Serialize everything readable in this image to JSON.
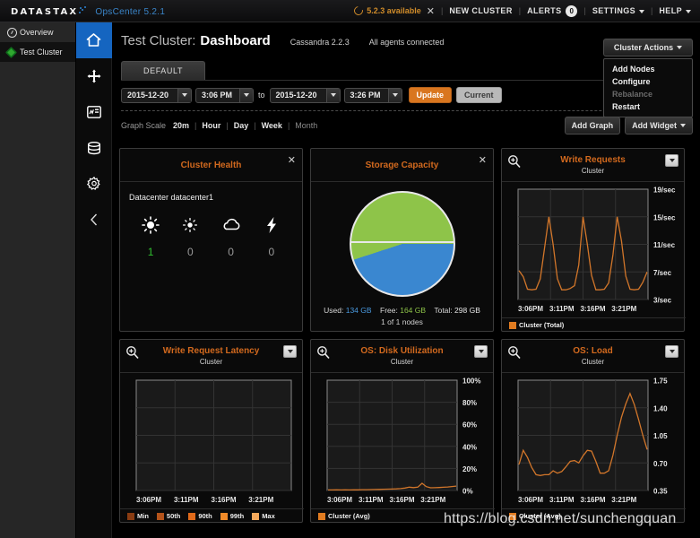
{
  "topbar": {
    "logo": "DATASTAX",
    "product": "OpsCenter 5.2.1",
    "available": "5.2.3 available",
    "close": "✕",
    "new_cluster": "NEW CLUSTER",
    "alerts": "ALERTS",
    "alerts_count": "0",
    "settings": "SETTINGS",
    "help": "HELP"
  },
  "sidebar": {
    "items": [
      {
        "label": "Overview",
        "icon": "gauge-icon"
      },
      {
        "label": "Test Cluster",
        "icon": "diamond-icon"
      }
    ]
  },
  "rail": {
    "items": [
      {
        "name": "home-icon"
      },
      {
        "name": "nodes-icon"
      },
      {
        "name": "dashboard-icon"
      },
      {
        "name": "database-icon"
      },
      {
        "name": "gear-icon"
      },
      {
        "name": "collapse-chevron-icon"
      }
    ]
  },
  "page": {
    "cluster": "Test Cluster:",
    "title": "Dashboard",
    "cassandra_version": "Cassandra 2.2.3",
    "agent_status": "All agents connected"
  },
  "cluster_actions": {
    "button": "Cluster Actions",
    "items": [
      {
        "label": "Add Nodes",
        "disabled": false
      },
      {
        "label": "Configure",
        "disabled": false
      },
      {
        "label": "Rebalance",
        "disabled": true
      },
      {
        "label": "Restart",
        "disabled": false
      }
    ]
  },
  "tabs": [
    {
      "label": "DEFAULT",
      "active": true
    }
  ],
  "daterange": {
    "start_date": "2015-12-20",
    "start_time": "3:06 PM",
    "to": "to",
    "end_date": "2015-12-20",
    "end_time": "3:26 PM",
    "update": "Update",
    "current": "Current"
  },
  "graph_scale": {
    "label": "Graph Scale",
    "options": [
      {
        "label": "20m",
        "state": "selected"
      },
      {
        "label": "Hour",
        "state": "normal"
      },
      {
        "label": "Day",
        "state": "normal"
      },
      {
        "label": "Week",
        "state": "normal"
      },
      {
        "label": "Month",
        "state": "dim"
      }
    ],
    "add_graph": "Add Graph",
    "add_widget": "Add Widget"
  },
  "widgets": {
    "cluster_health": {
      "title": "Cluster Health",
      "datacenter": "Datacenter datacenter1",
      "cells": [
        {
          "icon": "sun-icon",
          "count": "1",
          "tone": "green"
        },
        {
          "icon": "sun-small-icon",
          "count": "0",
          "tone": "grey"
        },
        {
          "icon": "cloud-icon",
          "count": "0",
          "tone": "grey"
        },
        {
          "icon": "bolt-icon",
          "count": "0",
          "tone": "grey"
        }
      ]
    },
    "storage_capacity": {
      "title": "Storage Capacity",
      "used_label": "Used:",
      "used_value": "134 GB",
      "free_label": "Free:",
      "free_value": "164 GB",
      "total_label": "Total:",
      "total_value": "298 GB",
      "nodes": "1 of 1 nodes",
      "used_color": "#4a9ae0",
      "free_color": "#8ec449"
    }
  },
  "chart_data": [
    {
      "type": "line",
      "title": "Write Requests",
      "subtitle": "Cluster",
      "xlabel": "",
      "ylabel": "",
      "ytick_labels": [
        "19/sec",
        "15/sec",
        "11/sec",
        "7/sec",
        "3/sec"
      ],
      "ylim": [
        3,
        19
      ],
      "xtick_labels": [
        "3:06PM",
        "3:11PM",
        "3:16PM",
        "3:21PM"
      ],
      "legend": [
        {
          "name": "Cluster (Total)",
          "color": "#e07b20"
        }
      ],
      "grid": true,
      "series": [
        {
          "name": "Cluster (Total)",
          "color": "#d2762a",
          "values": [
            7.2,
            6.3,
            4.5,
            4.4,
            4.5,
            6.0,
            10.5,
            15.0,
            11.0,
            6.0,
            4.4,
            4.4,
            4.6,
            5.0,
            8.0,
            15.0,
            11.0,
            6.5,
            4.4,
            4.4,
            4.5,
            5.4,
            9.5,
            15.0,
            11.5,
            6.4,
            4.5,
            4.4,
            4.5,
            5.5,
            7.0
          ]
        }
      ]
    },
    {
      "type": "line",
      "title": "Write Request Latency",
      "subtitle": "Cluster",
      "xlabel": "",
      "ylabel": "",
      "ytick_labels": [],
      "xtick_labels": [
        "3:06PM",
        "3:11PM",
        "3:16PM",
        "3:21PM"
      ],
      "legend": [
        {
          "name": "Min",
          "color": "#8a3c12"
        },
        {
          "name": "50th",
          "color": "#b4531a"
        },
        {
          "name": "90th",
          "color": "#e06a1a"
        },
        {
          "name": "99th",
          "color": "#f08a28"
        },
        {
          "name": "Max",
          "color": "#f5a95c"
        }
      ],
      "grid": true,
      "series": []
    },
    {
      "type": "line",
      "title": "OS: Disk Utilization",
      "subtitle": "Cluster",
      "xlabel": "",
      "ylabel": "",
      "ytick_labels": [
        "100%",
        "80%",
        "60%",
        "40%",
        "20%",
        "0%"
      ],
      "ylim": [
        0,
        100
      ],
      "xtick_labels": [
        "3:06PM",
        "3:11PM",
        "3:16PM",
        "3:21PM"
      ],
      "legend": [
        {
          "name": "Cluster (Avg)",
          "color": "#e07b20"
        }
      ],
      "grid": true,
      "series": [
        {
          "name": "Cluster (Avg)",
          "color": "#d2762a",
          "values": [
            0.5,
            0.5,
            0.6,
            0.5,
            0.6,
            0.5,
            0.6,
            0.6,
            0.7,
            0.7,
            0.8,
            0.9,
            1.0,
            1.1,
            1.2,
            1.3,
            1.5,
            1.7,
            2.2,
            3.0,
            2.6,
            3.0,
            6.5,
            3.5,
            2.4,
            2.5,
            2.7,
            2.9,
            3.2,
            3.6,
            4.0
          ]
        }
      ]
    },
    {
      "type": "line",
      "title": "OS: Load",
      "subtitle": "Cluster",
      "xlabel": "",
      "ylabel": "",
      "ytick_labels": [
        "1.75",
        "1.40",
        "1.05",
        "0.70",
        "0.35"
      ],
      "ylim": [
        0.35,
        1.75
      ],
      "xtick_labels": [
        "3:06PM",
        "3:11PM",
        "3:16PM",
        "3:21PM"
      ],
      "legend": [
        {
          "name": "Cluster (Avg)",
          "color": "#e07b20"
        }
      ],
      "grid": true,
      "series": [
        {
          "name": "Cluster (Avg)",
          "color": "#d2762a",
          "values": [
            0.68,
            0.86,
            0.77,
            0.64,
            0.55,
            0.54,
            0.55,
            0.55,
            0.6,
            0.57,
            0.59,
            0.65,
            0.72,
            0.73,
            0.7,
            0.79,
            0.86,
            0.85,
            0.72,
            0.57,
            0.57,
            0.6,
            0.8,
            1.05,
            1.28,
            1.45,
            1.58,
            1.44,
            1.25,
            1.05,
            0.87
          ]
        }
      ]
    }
  ],
  "watermark": "https://blog.csdn.net/sunchengquan"
}
